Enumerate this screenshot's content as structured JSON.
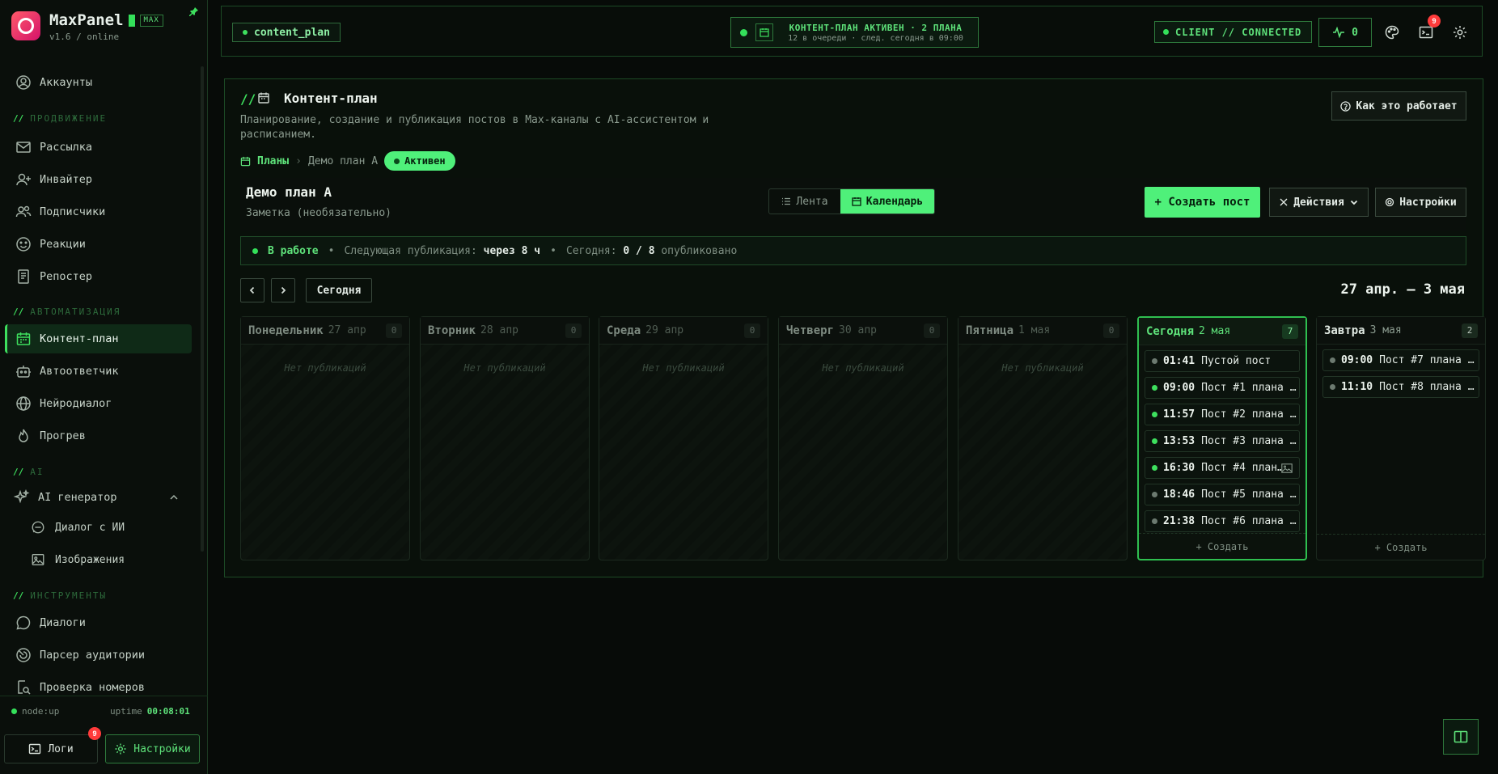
{
  "brand": {
    "name": "MaxPanel",
    "tag": "MAX",
    "version": "v1.6 / online"
  },
  "sidebar": {
    "top_item": "Аккаунты",
    "sections": {
      "promo": "ПРОДВИЖЕНИЕ",
      "auto": "АВТОМАТИЗАЦИЯ",
      "ai": "AI",
      "tools": "ИНСТРУМЕНТЫ"
    },
    "slash": "//",
    "promo_items": [
      "Рассылка",
      "Инвайтер",
      "Подписчики",
      "Реакции",
      "Репостер"
    ],
    "auto_items": [
      "Контент-план",
      "Автоответчик",
      "Нейродиалог",
      "Прогрев"
    ],
    "ai_group": "AI генератор",
    "ai_items": [
      "Диалог с ИИ",
      "Изображения"
    ],
    "tools_items": [
      "Диалоги",
      "Парсер аудитории",
      "Проверка номеров"
    ],
    "footer": {
      "node": "node:up",
      "uptime_label": "uptime",
      "uptime": "00:08:01",
      "logs": "Логи",
      "logs_badge": "9",
      "settings": "Настройки"
    }
  },
  "topbar": {
    "route": "content_plan",
    "status_title": "КОНТЕНТ-ПЛАН АКТИВЕН · 2 ПЛАНА",
    "status_sub": "12 в очереди · след. сегодня в 09:00",
    "client": "CLIENT // CONNECTED",
    "pulse_value": "0",
    "terminal_badge": "9"
  },
  "page": {
    "slash": "//",
    "title": "Контент-план",
    "description": "Планирование, создание и публикация постов в Max-каналы с AI-ассистентом и расписанием.",
    "how_button": "Как это работает",
    "breadcrumb_root": "Планы",
    "breadcrumb_sep": "›",
    "breadcrumb_current": "Демо план А",
    "status_pill": "Активен"
  },
  "plan": {
    "name": "Демо план А",
    "note_placeholder": "Заметка (необязательно)",
    "view_feed": "Лента",
    "view_calendar": "Календарь",
    "create_post": "+ Создать пост",
    "actions": "Действия",
    "settings": "Настройки"
  },
  "workbar": {
    "state": "В работе",
    "sep": "•",
    "next_label": "Следующая публикация:",
    "next_value": "через 8 ч",
    "today_label": "Сегодня:",
    "today_value": "0 / 8",
    "published": "опубликовано"
  },
  "calendar": {
    "today_button": "Сегодня",
    "range": "27 апр. — 3 мая",
    "empty_text": "Нет публикаций",
    "add_text": "+ Создать",
    "days": [
      {
        "name": "Понедельник",
        "date": "27 апр",
        "count": "0"
      },
      {
        "name": "Вторник",
        "date": "28 апр",
        "count": "0"
      },
      {
        "name": "Среда",
        "date": "29 апр",
        "count": "0"
      },
      {
        "name": "Четверг",
        "date": "30 апр",
        "count": "0"
      },
      {
        "name": "Пятница",
        "date": "1 мая",
        "count": "0"
      },
      {
        "name": "Сегодня",
        "date": "2 мая",
        "count": "7",
        "posts": [
          {
            "time": "01:41",
            "title": "Пустой пост",
            "status": "draft"
          },
          {
            "time": "09:00",
            "title": "Пост #1 плана …",
            "status": "scheduled"
          },
          {
            "time": "11:57",
            "title": "Пост #2 плана …",
            "status": "scheduled"
          },
          {
            "time": "13:53",
            "title": "Пост #3 плана …",
            "status": "scheduled"
          },
          {
            "time": "16:30",
            "title": "Пост #4 план…",
            "status": "scheduled",
            "has_image": true
          },
          {
            "time": "18:46",
            "title": "Пост #5 плана …",
            "status": "draft"
          },
          {
            "time": "21:38",
            "title": "Пост #6 плана …",
            "status": "draft"
          }
        ]
      },
      {
        "name": "Завтра",
        "date": "3 мая",
        "count": "2",
        "posts": [
          {
            "time": "09:00",
            "title": "Пост #7 плана …",
            "status": "draft"
          },
          {
            "time": "11:10",
            "title": "Пост #8 плана …",
            "status": "draft"
          }
        ]
      }
    ]
  },
  "colors": {
    "accent": "#4ff07a",
    "accent_dim": "#2e7a3c",
    "bg": "#070b08",
    "badge": "#ff3b3b"
  }
}
